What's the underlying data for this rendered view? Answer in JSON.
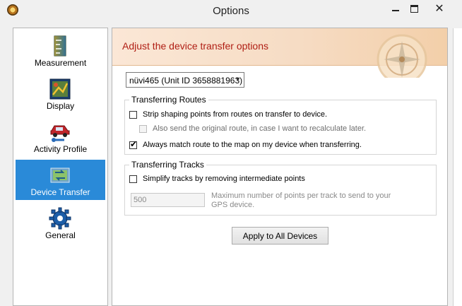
{
  "window": {
    "title": "Options",
    "close_glyph": "✕"
  },
  "sidebar": {
    "items": [
      {
        "label": "Measurement",
        "icon": "ruler-icon"
      },
      {
        "label": "Display",
        "icon": "display-icon"
      },
      {
        "label": "Activity Profile",
        "icon": "car-icon"
      },
      {
        "label": "Device Transfer",
        "icon": "device-transfer-icon",
        "selected": true
      },
      {
        "label": "General",
        "icon": "gear-icon"
      }
    ]
  },
  "main": {
    "banner": "Adjust the device transfer options",
    "device_select": {
      "value": "nüvi465 (Unit ID 3658881963)",
      "chevron": "▼"
    },
    "routes": {
      "title": "Transferring Routes",
      "strip_shaping": {
        "label": "Strip shaping points from routes on transfer to device.",
        "checked": false
      },
      "send_original": {
        "label": "Also send the original route, in case I want to recalculate later.",
        "checked": false,
        "enabled": false
      },
      "match_route": {
        "label": "Always match route to the map on my device when transferring.",
        "checked": true,
        "tick": "✔"
      }
    },
    "tracks": {
      "title": "Transferring Tracks",
      "simplify": {
        "label": "Simplify tracks by removing intermediate points",
        "checked": false
      },
      "max_points_value": "500",
      "max_points_help": "Maximum number of points per track to send to your GPS device."
    },
    "apply_button": "Apply to All Devices"
  },
  "colors": {
    "accent": "#2a8ad8",
    "banner_text": "#b01e14"
  }
}
